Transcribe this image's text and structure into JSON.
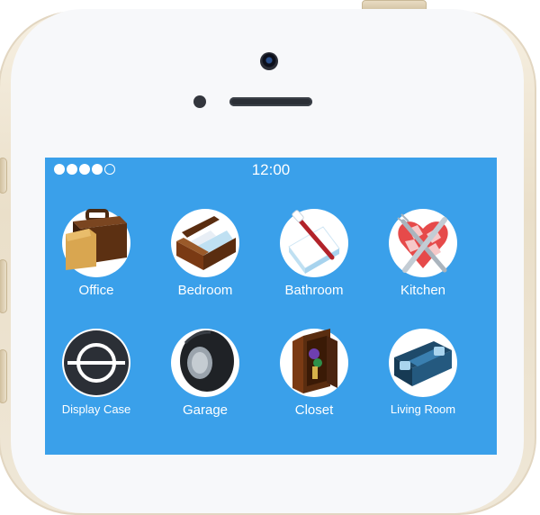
{
  "status_bar": {
    "time": "12:00",
    "signal_filled": 4,
    "signal_total": 5
  },
  "apps": [
    {
      "id": "office",
      "label": "Office",
      "icon": "briefcase-icon"
    },
    {
      "id": "bedroom",
      "label": "Bedroom",
      "icon": "bed-icon"
    },
    {
      "id": "bathroom",
      "label": "Bathroom",
      "icon": "toothbrush-icon"
    },
    {
      "id": "kitchen",
      "label": "Kitchen",
      "icon": "fork-knife-icon"
    },
    {
      "id": "display_case",
      "label": "Display Case",
      "icon": "display-case-icon"
    },
    {
      "id": "garage",
      "label": "Garage",
      "icon": "tire-icon"
    },
    {
      "id": "closet",
      "label": "Closet",
      "icon": "closet-icon"
    },
    {
      "id": "living_room",
      "label": "Living Room",
      "icon": "sofa-icon"
    }
  ],
  "colors": {
    "screen_bg": "#3aa0ea",
    "phone_frame": "#eadfc9"
  }
}
